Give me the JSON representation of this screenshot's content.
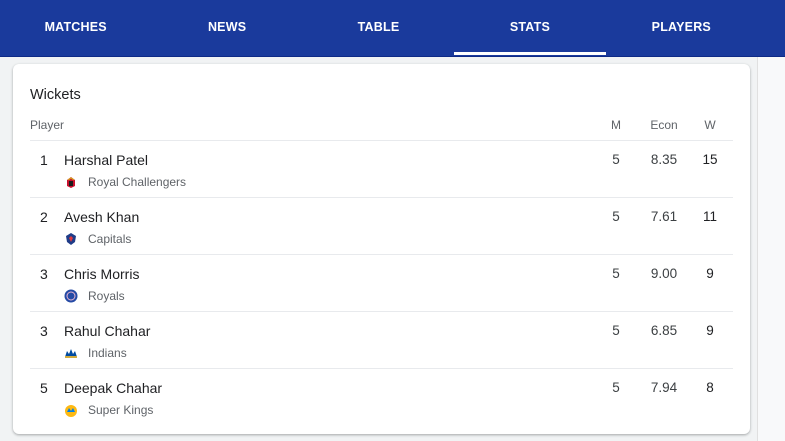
{
  "nav": {
    "tabs": [
      {
        "label": "MATCHES"
      },
      {
        "label": "NEWS"
      },
      {
        "label": "TABLE"
      },
      {
        "label": "STATS",
        "active": true
      },
      {
        "label": "PLAYERS"
      }
    ]
  },
  "stats": {
    "title": "Wickets",
    "headers": {
      "player": "Player",
      "matches": "M",
      "econ": "Econ",
      "wickets": "W"
    },
    "rows": [
      {
        "rank": "1",
        "name": "Harshal Patel",
        "team": "Royal Challengers",
        "team_icon": "royal-challengers-logo-icon",
        "m": "5",
        "econ": "8.35",
        "w": "15"
      },
      {
        "rank": "2",
        "name": "Avesh Khan",
        "team": "Capitals",
        "team_icon": "capitals-logo-icon",
        "m": "5",
        "econ": "7.61",
        "w": "11"
      },
      {
        "rank": "3",
        "name": "Chris Morris",
        "team": "Royals",
        "team_icon": "royals-logo-icon",
        "m": "5",
        "econ": "9.00",
        "w": "9"
      },
      {
        "rank": "3",
        "name": "Rahul Chahar",
        "team": "Indians",
        "team_icon": "indians-logo-icon",
        "m": "5",
        "econ": "6.85",
        "w": "9"
      },
      {
        "rank": "5",
        "name": "Deepak Chahar",
        "team": "Super Kings",
        "team_icon": "super-kings-logo-icon",
        "m": "5",
        "econ": "7.94",
        "w": "8"
      }
    ]
  },
  "colors": {
    "nav_background": "#1a3a9c",
    "tab_text": "#ffffff",
    "active_indicator": "#ffffff",
    "card_background": "#ffffff",
    "secondary_text": "#5f6368"
  }
}
